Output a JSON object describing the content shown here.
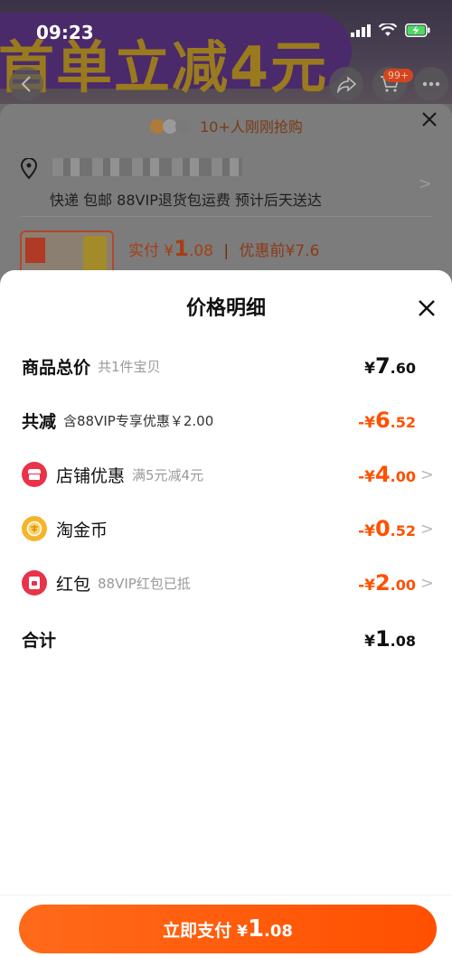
{
  "status_bar": {
    "time": "09:23"
  },
  "background": {
    "banner_text": "首单立减4元",
    "cart_badge": "99+",
    "ticker_text": "10+人刚刚抢购",
    "delivery_text": "快递 包邮 88VIP退货包运费 预计后天送达",
    "price": {
      "label": "实付",
      "currency": "¥",
      "integer": "1",
      "decimal": ".08",
      "original_label": "优惠前",
      "original_value": "¥7.6"
    }
  },
  "sheet": {
    "title": "价格明细",
    "rows": [
      {
        "label": "商品总价",
        "sub": "共1件宝贝",
        "currency": "¥",
        "integer": "7",
        "decimal": ".60"
      },
      {
        "label": "共减",
        "sub": "含88VIP专享优惠￥2.00",
        "currency": "-¥",
        "integer": "6",
        "decimal": ".52"
      },
      {
        "label": "店铺优惠",
        "sub": "满5元减4元",
        "currency": "-¥",
        "integer": "4",
        "decimal": ".00",
        "icon": "shop-icon"
      },
      {
        "label": "淘金币",
        "sub": "",
        "currency": "-¥",
        "integer": "0",
        "decimal": ".52",
        "icon": "gold-coin-icon"
      },
      {
        "label": "红包",
        "sub": "88VIP红包已抵",
        "currency": "-¥",
        "integer": "2",
        "decimal": ".00",
        "icon": "red-packet-icon"
      },
      {
        "label": "合计",
        "sub": "",
        "currency": "¥",
        "integer": "1",
        "decimal": ".08"
      }
    ]
  },
  "pay_button": {
    "label": "立即支付",
    "currency": "¥",
    "integer": "1",
    "decimal": ".08"
  },
  "colors": {
    "accent": "#ff5000",
    "shop_icon": "#e8334a",
    "coin_icon": "#f5b42a",
    "packet_icon": "#e8334a"
  }
}
